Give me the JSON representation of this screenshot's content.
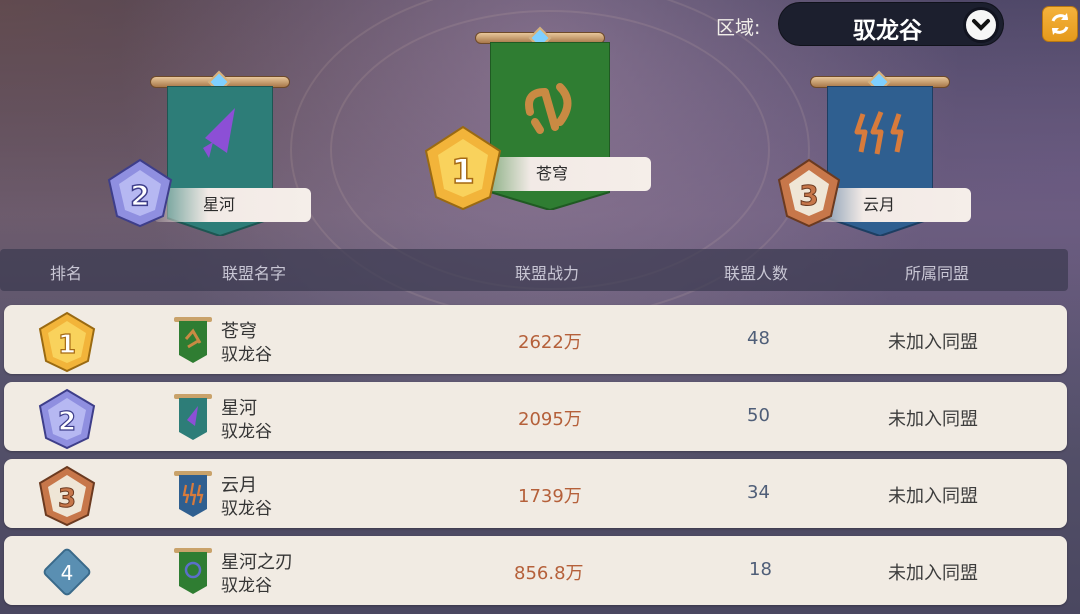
{
  "topbar": {
    "region_label": "区域:",
    "region_value": "驭龙谷",
    "chevron_icon": "chevron-down-icon",
    "refresh_icon": "refresh-icon"
  },
  "podium": [
    {
      "rank": "1",
      "name": "苍穹",
      "banner_color": "#2f7d32",
      "emblem_color": "#c98a43"
    },
    {
      "rank": "2",
      "name": "星河",
      "banner_color": "#2d7d78",
      "emblem_color": "#8c4fd6"
    },
    {
      "rank": "3",
      "name": "云月",
      "banner_color": "#2f5f90",
      "emblem_color": "#d77b3c"
    }
  ],
  "table": {
    "headers": {
      "rank": "排名",
      "name": "联盟名字",
      "power": "联盟战力",
      "members": "联盟人数",
      "league": "所属同盟"
    },
    "rows": [
      {
        "rank": "1",
        "name": "苍穹",
        "region": "驭龙谷",
        "power": "2622万",
        "members": "48",
        "league": "未加入同盟"
      },
      {
        "rank": "2",
        "name": "星河",
        "region": "驭龙谷",
        "power": "2095万",
        "members": "50",
        "league": "未加入同盟"
      },
      {
        "rank": "3",
        "name": "云月",
        "region": "驭龙谷",
        "power": "1739万",
        "members": "34",
        "league": "未加入同盟"
      },
      {
        "rank": "4",
        "name": "星河之刃",
        "region": "驭龙谷",
        "power": "856.8万",
        "members": "18",
        "league": "未加入同盟"
      }
    ]
  },
  "colors": {
    "gold": "#f0b433",
    "silver": "#8f8fe0",
    "bronze": "#c7774a",
    "rank4": "#5a8fb2"
  }
}
